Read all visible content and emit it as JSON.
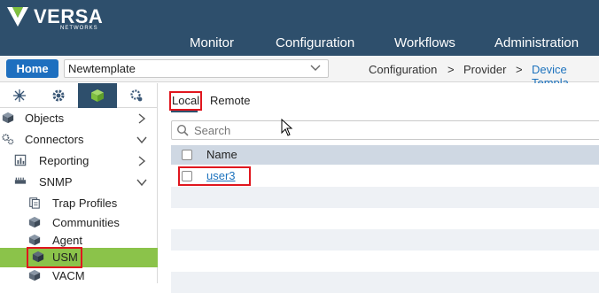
{
  "brand": {
    "name": "VERSA",
    "sub": "NETWORKS"
  },
  "nav": [
    "Monitor",
    "Configuration",
    "Workflows",
    "Administration"
  ],
  "toolbar": {
    "home_label": "Home",
    "template_value": "Newtemplate",
    "breadcrumb": [
      "Configuration",
      ">",
      "Provider",
      ">",
      "Device Templa"
    ]
  },
  "sidebar": {
    "tabs": [
      "network-icon",
      "gear-icon",
      "cube-icon",
      "settings-network-icon"
    ],
    "items": [
      {
        "label": "Objects",
        "icon": "cube-icon",
        "chevron": "right"
      },
      {
        "label": "Connectors",
        "icon": "gears-icon",
        "chevron": "down"
      },
      {
        "label": "Reporting",
        "icon": "report-icon",
        "chevron": "right"
      },
      {
        "label": "SNMP",
        "icon": "ethernet-icon",
        "chevron": "down"
      },
      {
        "label": "Trap Profiles",
        "icon": "document-icon"
      },
      {
        "label": "Communities",
        "icon": "cube-icon"
      },
      {
        "label": "Agent",
        "icon": "cube-icon"
      },
      {
        "label": "USM",
        "icon": "cube-icon",
        "selected": true
      },
      {
        "label": "VACM",
        "icon": "cube-icon"
      }
    ]
  },
  "main": {
    "tabs": [
      "Local",
      "Remote"
    ],
    "active_tab": "Local",
    "search_placeholder": "Search",
    "columns": [
      "Name"
    ],
    "rows": [
      {
        "name": "user3"
      }
    ]
  },
  "colors": {
    "topbar": "#2e4f6c",
    "accent": "#1e6fbf",
    "selected": "#8bc34a",
    "highlight": "#e0161e"
  }
}
